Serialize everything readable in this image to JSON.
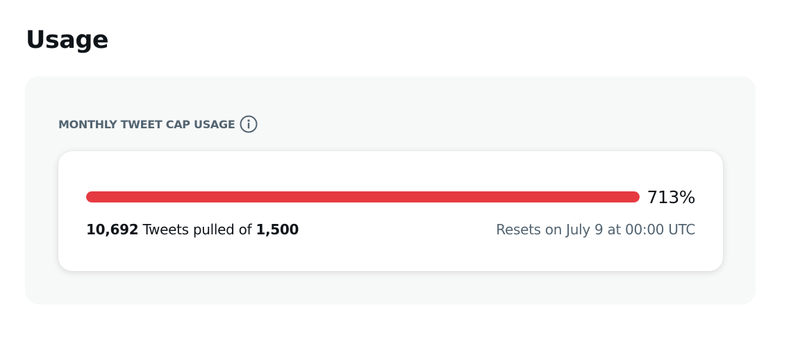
{
  "page": {
    "title": "Usage"
  },
  "tweet_cap": {
    "section_label": "MONTHLY TWEET CAP USAGE",
    "info_icon": "info-circle-icon",
    "percent_label": "713%",
    "fill_fraction": 1.0,
    "pulled_count": "10,692",
    "pulled_text": "Tweets pulled of",
    "cap_count": "1,500",
    "reset_text": "Resets on July 9 at 00:00 UTC"
  },
  "colors": {
    "bar_fill": "#e53a40",
    "label": "#536471",
    "text": "#0f1419",
    "panel_bg": "#f7f8f8"
  }
}
